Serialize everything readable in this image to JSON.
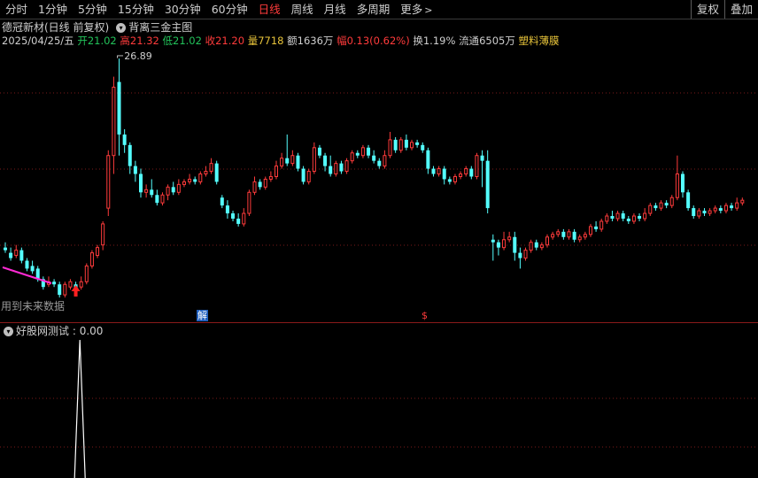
{
  "toolbar": {
    "tabs": [
      {
        "label": "分时",
        "active": false
      },
      {
        "label": "1分钟",
        "active": false
      },
      {
        "label": "5分钟",
        "active": false
      },
      {
        "label": "15分钟",
        "active": false
      },
      {
        "label": "30分钟",
        "active": false
      },
      {
        "label": "60分钟",
        "active": false
      },
      {
        "label": "日线",
        "active": true
      },
      {
        "label": "周线",
        "active": false
      },
      {
        "label": "月线",
        "active": false
      },
      {
        "label": "多周期",
        "active": false
      },
      {
        "label": "更多",
        "active": false
      }
    ],
    "more_chevron": ">",
    "right_buttons": [
      "复权",
      "叠加"
    ]
  },
  "stock": {
    "title": "德冠新材(日线 前复权)",
    "formula": "背离三金主图",
    "date": "2025/04/25/五",
    "open_label": "开",
    "open": "21.02",
    "high_label": "高",
    "high": "21.32",
    "low_label": "低",
    "low": "21.02",
    "close_label": "收",
    "close": "21.20",
    "vol_label": "量",
    "vol": "7718",
    "amount_label": "额",
    "amount": "1636万",
    "change_label": "幅",
    "change": "0.13(0.62%)",
    "turnover_label": "换",
    "turnover": "1.19%",
    "float_label": "流通",
    "float": "6505万",
    "concept": "塑料薄膜"
  },
  "main_chart": {
    "max_price_label": "26.89",
    "future_data_label": "用到未来数据",
    "jie_badge": "解",
    "s_badge": "$",
    "colors": {
      "up": "#ff3b3b",
      "down": "#54ffff",
      "grid": "#7a1a1a",
      "pink": "#ff2ad4",
      "arrow": "#ff2020"
    }
  },
  "indicator": {
    "name": "好股网测试",
    "value": "0.00",
    "header_sep": " : "
  },
  "chart_data": {
    "type": "candlestick",
    "ylim": [
      17.5,
      27.5
    ],
    "candles": [
      [
        19.7,
        19.6,
        19.5,
        19.9
      ],
      [
        19.5,
        19.3,
        19.2,
        19.7
      ],
      [
        19.4,
        19.6,
        19.3,
        19.8
      ],
      [
        19.6,
        19.2,
        19.1,
        19.7
      ],
      [
        19.2,
        18.9,
        18.8,
        19.3
      ],
      [
        19.0,
        18.8,
        18.7,
        19.2
      ],
      [
        18.9,
        18.5,
        18.4,
        19.0
      ],
      [
        18.5,
        18.2,
        18.1,
        18.6
      ],
      [
        18.3,
        18.4,
        18.2,
        18.6
      ],
      [
        18.4,
        18.3,
        18.2,
        18.5
      ],
      [
        18.3,
        17.9,
        17.8,
        18.4
      ],
      [
        17.9,
        18.3,
        17.8,
        18.4
      ],
      [
        18.2,
        18.4,
        18.1,
        18.5
      ],
      [
        18.3,
        18.1,
        18.0,
        18.4
      ],
      [
        18.2,
        18.4,
        18.1,
        18.6
      ],
      [
        18.4,
        19.0,
        18.3,
        19.1
      ],
      [
        19.0,
        19.5,
        18.9,
        19.6
      ],
      [
        19.4,
        19.7,
        19.3,
        19.8
      ],
      [
        19.8,
        20.6,
        19.6,
        20.7
      ],
      [
        21.2,
        23.2,
        20.9,
        23.4
      ],
      [
        23.2,
        25.8,
        22.5,
        26.2
      ],
      [
        26.0,
        24.0,
        23.2,
        26.89
      ],
      [
        24.0,
        23.6,
        23.3,
        24.2
      ],
      [
        23.6,
        22.8,
        22.5,
        23.7
      ],
      [
        22.8,
        22.5,
        22.2,
        23.0
      ],
      [
        22.5,
        21.8,
        21.6,
        22.7
      ],
      [
        21.8,
        21.9,
        21.6,
        22.1
      ],
      [
        21.9,
        21.7,
        21.6,
        22.3
      ],
      [
        21.7,
        21.4,
        21.3,
        21.9
      ],
      [
        21.4,
        21.7,
        21.3,
        21.8
      ],
      [
        21.7,
        22.0,
        21.5,
        22.1
      ],
      [
        22.0,
        21.8,
        21.7,
        22.2
      ],
      [
        21.8,
        22.1,
        21.7,
        22.3
      ],
      [
        22.1,
        22.2,
        22.0,
        22.3
      ],
      [
        22.2,
        22.3,
        22.1,
        22.5
      ],
      [
        22.3,
        22.2,
        22.1,
        22.4
      ],
      [
        22.2,
        22.5,
        22.1,
        22.6
      ],
      [
        22.5,
        22.6,
        22.4,
        22.8
      ],
      [
        22.6,
        22.9,
        22.5,
        23.1
      ],
      [
        22.9,
        22.2,
        22.1,
        23.0
      ],
      [
        21.6,
        21.3,
        21.2,
        21.7
      ],
      [
        21.3,
        21.0,
        20.8,
        21.5
      ],
      [
        21.0,
        20.8,
        20.7,
        21.1
      ],
      [
        20.8,
        20.6,
        20.5,
        21.0
      ],
      [
        20.6,
        21.0,
        20.5,
        21.2
      ],
      [
        21.0,
        21.8,
        20.9,
        21.9
      ],
      [
        21.8,
        22.2,
        21.7,
        22.4
      ],
      [
        22.2,
        22.0,
        21.9,
        22.3
      ],
      [
        22.0,
        22.3,
        21.9,
        22.4
      ],
      [
        22.3,
        22.4,
        22.2,
        22.6
      ],
      [
        22.4,
        22.8,
        22.3,
        23.0
      ],
      [
        22.8,
        23.1,
        22.7,
        23.3
      ],
      [
        23.1,
        22.9,
        22.8,
        24.0
      ],
      [
        22.9,
        23.2,
        22.8,
        23.4
      ],
      [
        23.2,
        22.7,
        22.6,
        23.3
      ],
      [
        22.7,
        22.2,
        22.1,
        22.8
      ],
      [
        22.2,
        22.6,
        22.1,
        22.7
      ],
      [
        22.6,
        23.5,
        22.5,
        23.7
      ],
      [
        23.5,
        23.2,
        23.1,
        23.6
      ],
      [
        23.2,
        22.8,
        22.6,
        23.3
      ],
      [
        22.8,
        22.5,
        22.4,
        23.2
      ],
      [
        22.5,
        22.9,
        22.4,
        23.0
      ],
      [
        22.9,
        22.6,
        22.5,
        23.0
      ],
      [
        22.6,
        23.0,
        22.5,
        23.1
      ],
      [
        23.0,
        23.3,
        22.9,
        23.4
      ],
      [
        23.3,
        23.2,
        23.1,
        23.4
      ],
      [
        23.2,
        23.5,
        23.1,
        23.6
      ],
      [
        23.5,
        23.2,
        23.1,
        23.6
      ],
      [
        23.2,
        23.0,
        22.9,
        23.4
      ],
      [
        23.0,
        22.8,
        22.7,
        23.1
      ],
      [
        22.8,
        23.2,
        22.7,
        23.4
      ],
      [
        23.2,
        23.8,
        23.1,
        24.1
      ],
      [
        23.8,
        23.4,
        23.3,
        23.9
      ],
      [
        23.4,
        23.8,
        23.3,
        23.9
      ],
      [
        23.8,
        23.5,
        23.4,
        24.0
      ],
      [
        23.5,
        23.7,
        23.4,
        23.8
      ],
      [
        23.7,
        23.6,
        23.5,
        23.8
      ],
      [
        23.6,
        23.4,
        23.3,
        23.7
      ],
      [
        23.4,
        22.7,
        22.5,
        23.5
      ],
      [
        22.7,
        22.5,
        22.4,
        22.8
      ],
      [
        22.5,
        22.7,
        22.4,
        22.8
      ],
      [
        22.7,
        22.3,
        22.1,
        22.8
      ],
      [
        22.3,
        22.2,
        22.1,
        22.4
      ],
      [
        22.2,
        22.4,
        22.1,
        22.5
      ],
      [
        22.4,
        22.5,
        22.3,
        22.6
      ],
      [
        22.5,
        22.7,
        22.4,
        22.8
      ],
      [
        22.7,
        22.4,
        22.3,
        22.8
      ],
      [
        22.4,
        23.2,
        22.3,
        23.3
      ],
      [
        23.2,
        23.0,
        22.0,
        23.4
      ],
      [
        23.0,
        21.2,
        21.0,
        23.4
      ],
      [
        20.0,
        19.9,
        19.2,
        20.2
      ],
      [
        19.9,
        19.7,
        19.4,
        20.0
      ],
      [
        19.7,
        20.0,
        19.6,
        20.3
      ],
      [
        20.0,
        20.1,
        19.9,
        20.3
      ],
      [
        20.1,
        19.5,
        19.2,
        20.3
      ],
      [
        19.5,
        19.3,
        18.9,
        19.7
      ],
      [
        19.3,
        19.6,
        19.2,
        19.7
      ],
      [
        19.6,
        19.9,
        19.5,
        20.0
      ],
      [
        19.9,
        19.7,
        19.6,
        20.0
      ],
      [
        19.7,
        19.8,
        19.6,
        19.9
      ],
      [
        19.8,
        20.1,
        19.7,
        20.2
      ],
      [
        20.1,
        20.2,
        20.0,
        20.3
      ],
      [
        20.2,
        20.3,
        20.1,
        20.4
      ],
      [
        20.3,
        20.1,
        20.0,
        20.4
      ],
      [
        20.1,
        20.3,
        20.0,
        20.4
      ],
      [
        20.3,
        20.0,
        19.9,
        20.4
      ],
      [
        20.0,
        20.1,
        19.9,
        20.2
      ],
      [
        20.1,
        20.2,
        20.0,
        20.3
      ],
      [
        20.2,
        20.5,
        20.1,
        20.6
      ],
      [
        20.5,
        20.4,
        20.3,
        20.7
      ],
      [
        20.4,
        20.7,
        20.3,
        20.8
      ],
      [
        20.7,
        20.9,
        20.6,
        21.0
      ],
      [
        20.9,
        20.8,
        20.7,
        21.1
      ],
      [
        20.8,
        21.0,
        20.7,
        21.1
      ],
      [
        21.0,
        20.8,
        20.7,
        21.1
      ],
      [
        20.8,
        20.7,
        20.6,
        20.9
      ],
      [
        20.7,
        20.9,
        20.6,
        21.0
      ],
      [
        20.9,
        20.8,
        20.7,
        21.0
      ],
      [
        20.8,
        21.0,
        20.7,
        21.2
      ],
      [
        21.0,
        21.3,
        20.9,
        21.4
      ],
      [
        21.3,
        21.2,
        21.1,
        21.4
      ],
      [
        21.2,
        21.4,
        21.1,
        21.5
      ],
      [
        21.4,
        21.3,
        21.2,
        21.5
      ],
      [
        21.3,
        21.6,
        21.2,
        21.7
      ],
      [
        21.6,
        22.5,
        21.5,
        23.2
      ],
      [
        22.5,
        21.8,
        21.6,
        22.6
      ],
      [
        21.8,
        21.2,
        21.1,
        21.9
      ],
      [
        21.2,
        20.9,
        20.8,
        21.3
      ],
      [
        20.9,
        21.1,
        20.8,
        21.2
      ],
      [
        21.1,
        21.0,
        20.9,
        21.2
      ],
      [
        21.0,
        21.1,
        20.9,
        21.2
      ],
      [
        21.1,
        21.2,
        21.0,
        21.3
      ],
      [
        21.2,
        21.1,
        21.0,
        21.3
      ],
      [
        21.1,
        21.3,
        21.0,
        21.4
      ],
      [
        21.3,
        21.2,
        21.1,
        21.4
      ],
      [
        21.2,
        21.4,
        21.1,
        21.6
      ],
      [
        21.4,
        21.5,
        21.3,
        21.6
      ]
    ],
    "indicator_series": {
      "name": "好股网测试",
      "spike_index": 10,
      "spike_value": 1,
      "base": 0
    }
  }
}
